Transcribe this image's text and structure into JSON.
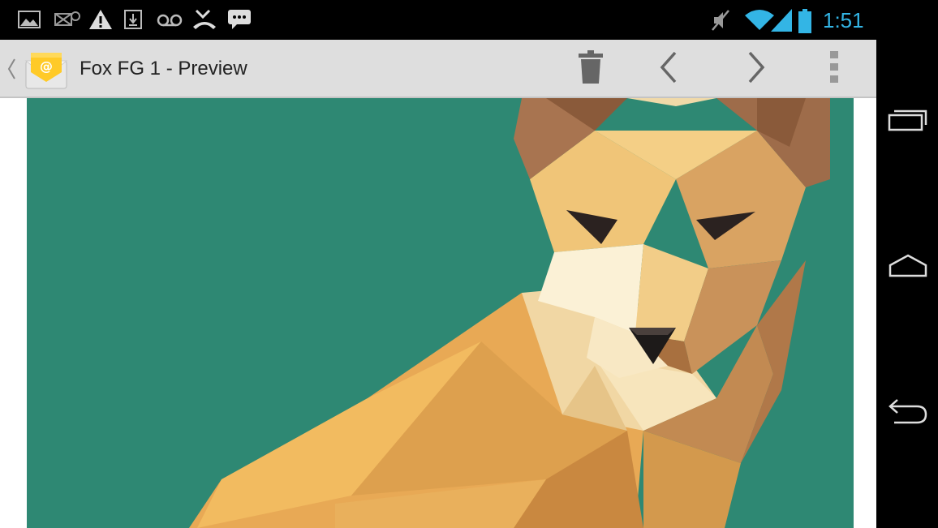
{
  "status_bar": {
    "time": "1:51",
    "notification_icons": [
      "gallery-icon",
      "email-failed-icon",
      "warning-icon",
      "download-icon",
      "voicemail-icon",
      "missed-call-icon",
      "chat-icon"
    ],
    "system_icons": [
      "mute-icon",
      "wifi-icon",
      "signal-icon",
      "battery-icon"
    ],
    "accent_color": "#33b5e5"
  },
  "action_bar": {
    "title": "Fox FG 1 - Preview",
    "app_icon": "email-app-icon",
    "actions": [
      "delete-icon",
      "previous-icon",
      "next-icon",
      "overflow-menu-icon"
    ]
  },
  "content": {
    "image": "low-poly-fox-illustration",
    "background_color": "#2e8873"
  },
  "nav_bar": {
    "buttons": [
      "recent-apps-icon",
      "home-icon",
      "back-icon"
    ]
  }
}
